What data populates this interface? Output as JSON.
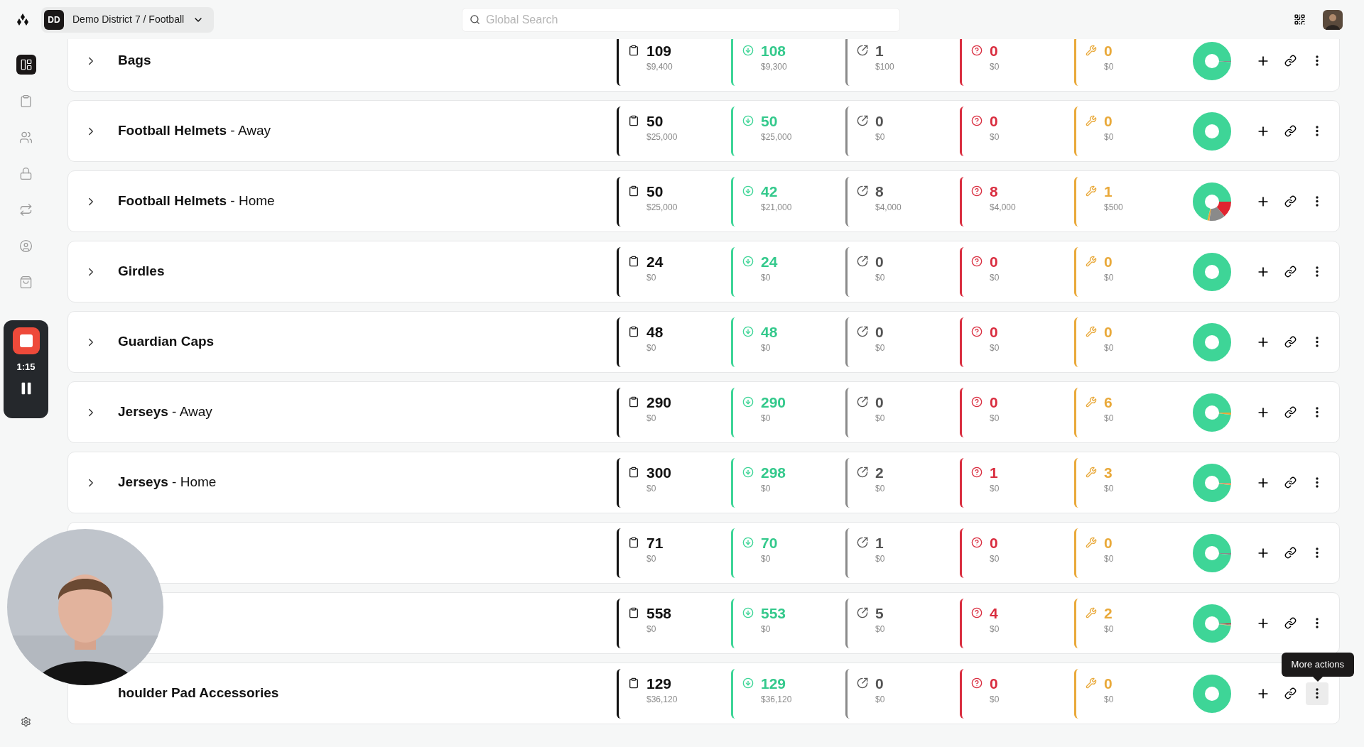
{
  "header": {
    "workspace": {
      "initials": "DD",
      "label": "Demo District 7 / Football"
    },
    "search": {
      "placeholder": "Global Search"
    }
  },
  "sidebar": {
    "items": [
      {
        "kind": "dashboard",
        "selected": true
      },
      {
        "kind": "clipboard",
        "selected": false
      },
      {
        "kind": "users",
        "selected": false
      },
      {
        "kind": "lock",
        "selected": false
      },
      {
        "kind": "swap",
        "selected": false
      },
      {
        "kind": "account",
        "selected": false
      },
      {
        "kind": "bag",
        "selected": false
      }
    ],
    "recorder": {
      "time": "1:15"
    }
  },
  "rows": [
    {
      "expanded": false,
      "name": "Bags",
      "stats": [
        {
          "kind": "total",
          "count": "109",
          "amount": "$9,400"
        },
        {
          "kind": "available",
          "count": "108",
          "amount": "$9,300"
        },
        {
          "kind": "checked_out",
          "count": "1",
          "amount": "$100"
        },
        {
          "kind": "missing",
          "count": "0",
          "amount": "$0"
        },
        {
          "kind": "repair",
          "count": "0",
          "amount": "$0"
        }
      ]
    },
    {
      "expanded": false,
      "name": "Football Helmets",
      "suffix": "- Away",
      "stats": [
        {
          "kind": "total",
          "count": "50",
          "amount": "$25,000"
        },
        {
          "kind": "available",
          "count": "50",
          "amount": "$25,000"
        },
        {
          "kind": "checked_out",
          "count": "0",
          "amount": "$0"
        },
        {
          "kind": "missing",
          "count": "0",
          "amount": "$0"
        },
        {
          "kind": "repair",
          "count": "0",
          "amount": "$0"
        }
      ]
    },
    {
      "expanded": false,
      "name": "Football Helmets",
      "suffix": "- Home",
      "stats": [
        {
          "kind": "total",
          "count": "50",
          "amount": "$25,000"
        },
        {
          "kind": "available",
          "count": "42",
          "amount": "$21,000"
        },
        {
          "kind": "checked_out",
          "count": "8",
          "amount": "$4,000"
        },
        {
          "kind": "missing",
          "count": "8",
          "amount": "$4,000"
        },
        {
          "kind": "repair",
          "count": "1",
          "amount": "$500"
        }
      ]
    },
    {
      "expanded": false,
      "name": "Girdles",
      "stats": [
        {
          "kind": "total",
          "count": "24",
          "amount": "$0"
        },
        {
          "kind": "available",
          "count": "24",
          "amount": "$0"
        },
        {
          "kind": "checked_out",
          "count": "0",
          "amount": "$0"
        },
        {
          "kind": "missing",
          "count": "0",
          "amount": "$0"
        },
        {
          "kind": "repair",
          "count": "0",
          "amount": "$0"
        }
      ]
    },
    {
      "expanded": false,
      "name": "Guardian Caps",
      "stats": [
        {
          "kind": "total",
          "count": "48",
          "amount": "$0"
        },
        {
          "kind": "available",
          "count": "48",
          "amount": "$0"
        },
        {
          "kind": "checked_out",
          "count": "0",
          "amount": "$0"
        },
        {
          "kind": "missing",
          "count": "0",
          "amount": "$0"
        },
        {
          "kind": "repair",
          "count": "0",
          "amount": "$0"
        }
      ]
    },
    {
      "expanded": false,
      "name": "Jerseys",
      "suffix": "- Away",
      "stats": [
        {
          "kind": "total",
          "count": "290",
          "amount": "$0"
        },
        {
          "kind": "available",
          "count": "290",
          "amount": "$0"
        },
        {
          "kind": "checked_out",
          "count": "0",
          "amount": "$0"
        },
        {
          "kind": "missing",
          "count": "0",
          "amount": "$0"
        },
        {
          "kind": "repair",
          "count": "6",
          "amount": "$0"
        }
      ]
    },
    {
      "expanded": false,
      "name": "Jerseys",
      "suffix": "- Home",
      "stats": [
        {
          "kind": "total",
          "count": "300",
          "amount": "$0"
        },
        {
          "kind": "available",
          "count": "298",
          "amount": "$0"
        },
        {
          "kind": "checked_out",
          "count": "2",
          "amount": "$0"
        },
        {
          "kind": "missing",
          "count": "1",
          "amount": "$0"
        },
        {
          "kind": "repair",
          "count": "3",
          "amount": "$0"
        }
      ]
    },
    {
      "stats": [
        {
          "kind": "total",
          "count": "71",
          "amount": "$0"
        },
        {
          "kind": "available",
          "count": "70",
          "amount": "$0"
        },
        {
          "kind": "checked_out",
          "count": "1",
          "amount": "$0"
        },
        {
          "kind": "missing",
          "count": "0",
          "amount": "$0"
        },
        {
          "kind": "repair",
          "count": "0",
          "amount": "$0"
        }
      ]
    },
    {
      "stats": [
        {
          "kind": "total",
          "count": "558",
          "amount": "$0"
        },
        {
          "kind": "available",
          "count": "553",
          "amount": "$0"
        },
        {
          "kind": "checked_out",
          "count": "5",
          "amount": "$0"
        },
        {
          "kind": "missing",
          "count": "4",
          "amount": "$0"
        },
        {
          "kind": "repair",
          "count": "2",
          "amount": "$0"
        }
      ]
    },
    {
      "name": "houlder Pad Accessories",
      "tooltip": "More actions",
      "stats": [
        {
          "kind": "total",
          "count": "129",
          "amount": "$36,120"
        },
        {
          "kind": "available",
          "count": "129",
          "amount": "$36,120"
        },
        {
          "kind": "checked_out",
          "count": "0",
          "amount": "$0"
        },
        {
          "kind": "missing",
          "count": "0",
          "amount": "$0"
        },
        {
          "kind": "repair",
          "count": "0",
          "amount": "$0"
        }
      ]
    }
  ]
}
